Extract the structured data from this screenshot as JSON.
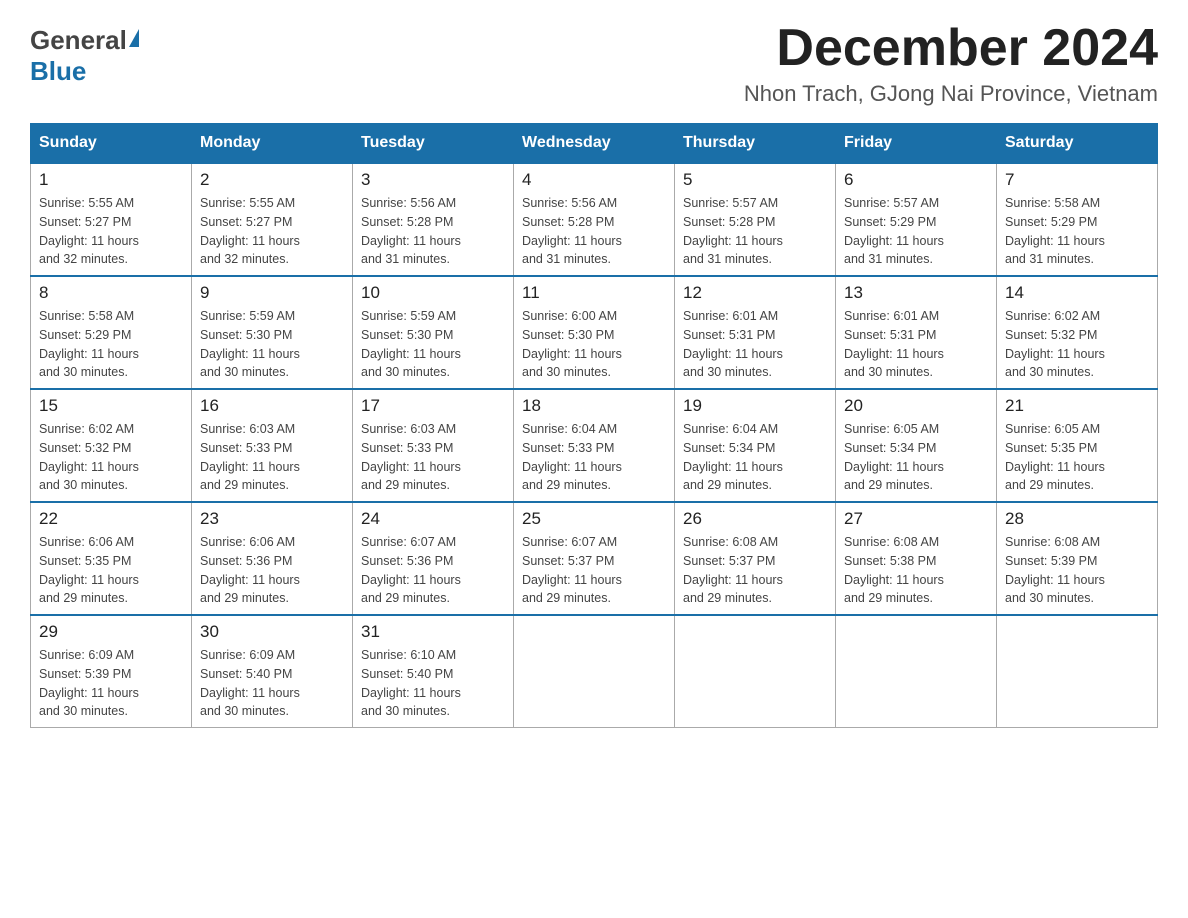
{
  "header": {
    "logo_general": "General",
    "logo_blue": "Blue",
    "month_title": "December 2024",
    "location": "Nhon Trach, GJong Nai Province, Vietnam"
  },
  "days_of_week": [
    "Sunday",
    "Monday",
    "Tuesday",
    "Wednesday",
    "Thursday",
    "Friday",
    "Saturday"
  ],
  "weeks": [
    [
      {
        "day": "1",
        "sunrise": "5:55 AM",
        "sunset": "5:27 PM",
        "daylight": "11 hours and 32 minutes."
      },
      {
        "day": "2",
        "sunrise": "5:55 AM",
        "sunset": "5:27 PM",
        "daylight": "11 hours and 32 minutes."
      },
      {
        "day": "3",
        "sunrise": "5:56 AM",
        "sunset": "5:28 PM",
        "daylight": "11 hours and 31 minutes."
      },
      {
        "day": "4",
        "sunrise": "5:56 AM",
        "sunset": "5:28 PM",
        "daylight": "11 hours and 31 minutes."
      },
      {
        "day": "5",
        "sunrise": "5:57 AM",
        "sunset": "5:28 PM",
        "daylight": "11 hours and 31 minutes."
      },
      {
        "day": "6",
        "sunrise": "5:57 AM",
        "sunset": "5:29 PM",
        "daylight": "11 hours and 31 minutes."
      },
      {
        "day": "7",
        "sunrise": "5:58 AM",
        "sunset": "5:29 PM",
        "daylight": "11 hours and 31 minutes."
      }
    ],
    [
      {
        "day": "8",
        "sunrise": "5:58 AM",
        "sunset": "5:29 PM",
        "daylight": "11 hours and 30 minutes."
      },
      {
        "day": "9",
        "sunrise": "5:59 AM",
        "sunset": "5:30 PM",
        "daylight": "11 hours and 30 minutes."
      },
      {
        "day": "10",
        "sunrise": "5:59 AM",
        "sunset": "5:30 PM",
        "daylight": "11 hours and 30 minutes."
      },
      {
        "day": "11",
        "sunrise": "6:00 AM",
        "sunset": "5:30 PM",
        "daylight": "11 hours and 30 minutes."
      },
      {
        "day": "12",
        "sunrise": "6:01 AM",
        "sunset": "5:31 PM",
        "daylight": "11 hours and 30 minutes."
      },
      {
        "day": "13",
        "sunrise": "6:01 AM",
        "sunset": "5:31 PM",
        "daylight": "11 hours and 30 minutes."
      },
      {
        "day": "14",
        "sunrise": "6:02 AM",
        "sunset": "5:32 PM",
        "daylight": "11 hours and 30 minutes."
      }
    ],
    [
      {
        "day": "15",
        "sunrise": "6:02 AM",
        "sunset": "5:32 PM",
        "daylight": "11 hours and 30 minutes."
      },
      {
        "day": "16",
        "sunrise": "6:03 AM",
        "sunset": "5:33 PM",
        "daylight": "11 hours and 29 minutes."
      },
      {
        "day": "17",
        "sunrise": "6:03 AM",
        "sunset": "5:33 PM",
        "daylight": "11 hours and 29 minutes."
      },
      {
        "day": "18",
        "sunrise": "6:04 AM",
        "sunset": "5:33 PM",
        "daylight": "11 hours and 29 minutes."
      },
      {
        "day": "19",
        "sunrise": "6:04 AM",
        "sunset": "5:34 PM",
        "daylight": "11 hours and 29 minutes."
      },
      {
        "day": "20",
        "sunrise": "6:05 AM",
        "sunset": "5:34 PM",
        "daylight": "11 hours and 29 minutes."
      },
      {
        "day": "21",
        "sunrise": "6:05 AM",
        "sunset": "5:35 PM",
        "daylight": "11 hours and 29 minutes."
      }
    ],
    [
      {
        "day": "22",
        "sunrise": "6:06 AM",
        "sunset": "5:35 PM",
        "daylight": "11 hours and 29 minutes."
      },
      {
        "day": "23",
        "sunrise": "6:06 AM",
        "sunset": "5:36 PM",
        "daylight": "11 hours and 29 minutes."
      },
      {
        "day": "24",
        "sunrise": "6:07 AM",
        "sunset": "5:36 PM",
        "daylight": "11 hours and 29 minutes."
      },
      {
        "day": "25",
        "sunrise": "6:07 AM",
        "sunset": "5:37 PM",
        "daylight": "11 hours and 29 minutes."
      },
      {
        "day": "26",
        "sunrise": "6:08 AM",
        "sunset": "5:37 PM",
        "daylight": "11 hours and 29 minutes."
      },
      {
        "day": "27",
        "sunrise": "6:08 AM",
        "sunset": "5:38 PM",
        "daylight": "11 hours and 29 minutes."
      },
      {
        "day": "28",
        "sunrise": "6:08 AM",
        "sunset": "5:39 PM",
        "daylight": "11 hours and 30 minutes."
      }
    ],
    [
      {
        "day": "29",
        "sunrise": "6:09 AM",
        "sunset": "5:39 PM",
        "daylight": "11 hours and 30 minutes."
      },
      {
        "day": "30",
        "sunrise": "6:09 AM",
        "sunset": "5:40 PM",
        "daylight": "11 hours and 30 minutes."
      },
      {
        "day": "31",
        "sunrise": "6:10 AM",
        "sunset": "5:40 PM",
        "daylight": "11 hours and 30 minutes."
      },
      null,
      null,
      null,
      null
    ]
  ],
  "labels": {
    "sunrise": "Sunrise:",
    "sunset": "Sunset:",
    "daylight": "Daylight:"
  }
}
